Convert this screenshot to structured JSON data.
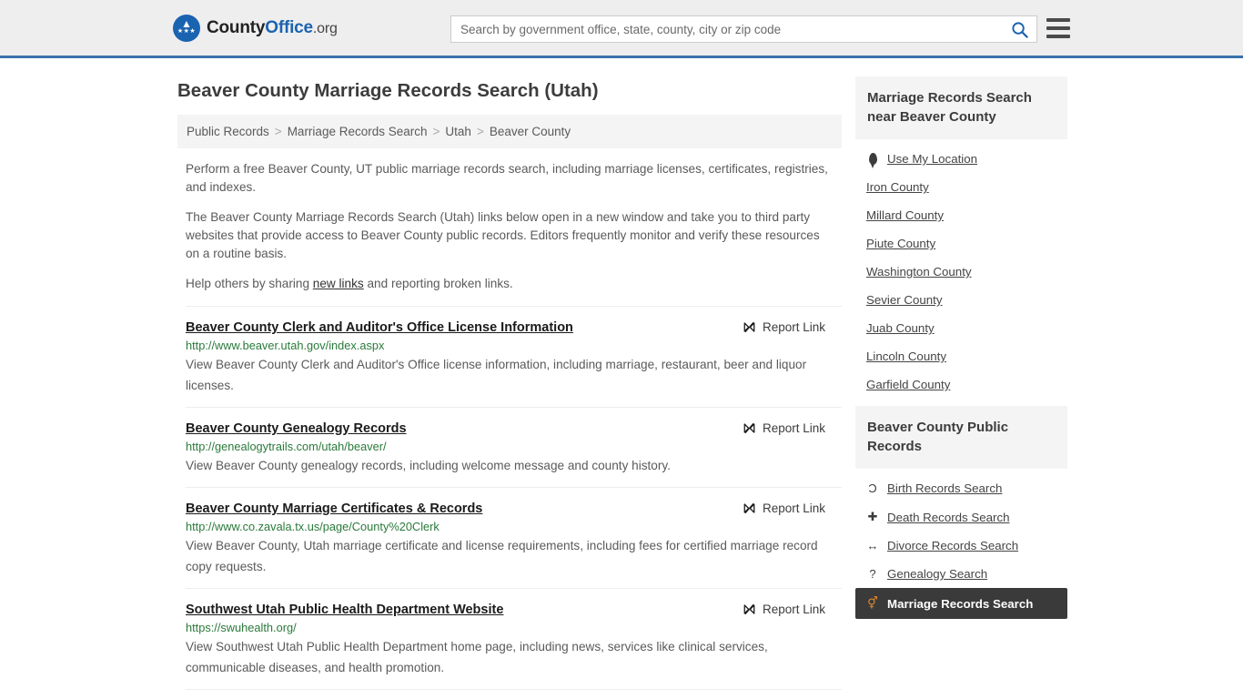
{
  "header": {
    "brand": {
      "part1": "County",
      "part2": "Office",
      "tld": ".org",
      "seal_icon": "eagle-seal-icon"
    },
    "search": {
      "placeholder": "Search by government office, state, county, city or zip code",
      "value": ""
    },
    "search_icon": "search-icon",
    "menu_icon": "hamburger-menu-icon"
  },
  "main": {
    "page_title": "Beaver County Marriage Records Search (Utah)",
    "breadcrumb": [
      "Public Records",
      "Marriage Records Search",
      "Utah",
      "Beaver County"
    ],
    "breadcrumb_separator": ">",
    "intro": {
      "p1": "Perform a free Beaver County, UT public marriage records search, including marriage licenses, certificates, registries, and indexes.",
      "p2": "The Beaver County Marriage Records Search (Utah) links below open in a new window and take you to third party websites that provide access to Beaver County public records. Editors frequently monitor and verify these resources on a routine basis.",
      "p3_before": "Help others by sharing ",
      "p3_link": "new links",
      "p3_after": " and reporting broken links."
    },
    "report_link_label": "Report Link",
    "report_link_icon": "broken-link-icon",
    "results": [
      {
        "title": "Beaver County Clerk and Auditor's Office License Information",
        "url": "http://www.beaver.utah.gov/index.aspx",
        "description": "View Beaver County Clerk and Auditor's Office license information, including marriage, restaurant, beer and liquor licenses."
      },
      {
        "title": "Beaver County Genealogy Records",
        "url": "http://genealogytrails.com/utah/beaver/",
        "description": "View Beaver County genealogy records, including welcome message and county history."
      },
      {
        "title": "Beaver County Marriage Certificates & Records",
        "url": "http://www.co.zavala.tx.us/page/County%20Clerk",
        "description": "View Beaver County, Utah marriage certificate and license requirements, including fees for certified marriage record copy requests."
      },
      {
        "title": "Southwest Utah Public Health Department Website",
        "url": "https://swuhealth.org/",
        "description": "View Southwest Utah Public Health Department home page, including news, services like clinical services, communicable diseases, and health promotion."
      }
    ]
  },
  "sidebar": {
    "nearby": {
      "heading": "Marriage Records Search near Beaver County",
      "items": [
        {
          "label": "Use My Location",
          "icon": "map-pin-icon"
        },
        {
          "label": "Iron County",
          "icon": ""
        },
        {
          "label": "Millard County",
          "icon": ""
        },
        {
          "label": "Piute County",
          "icon": ""
        },
        {
          "label": "Washington County",
          "icon": ""
        },
        {
          "label": "Sevier County",
          "icon": ""
        },
        {
          "label": "Juab County",
          "icon": ""
        },
        {
          "label": "Lincoln County",
          "icon": ""
        },
        {
          "label": "Garfield County",
          "icon": ""
        }
      ]
    },
    "public_records": {
      "heading": "Beaver County Public Records",
      "items": [
        {
          "label": "Birth Records Search",
          "icon": "baby-icon",
          "glyph": "Ɔ",
          "active": false
        },
        {
          "label": "Death Records Search",
          "icon": "cross-icon",
          "glyph": "✚",
          "active": false
        },
        {
          "label": "Divorce Records Search",
          "icon": "double-arrow-icon",
          "glyph": "↔",
          "active": false
        },
        {
          "label": "Genealogy Search",
          "icon": "question-mark-icon",
          "glyph": "?",
          "active": false
        },
        {
          "label": "Marriage Records Search",
          "icon": "venus-mars-icon",
          "glyph": "⚥",
          "active": true
        }
      ]
    }
  },
  "colors": {
    "brand_blue": "#1a63b0",
    "header_bg": "#eeeeee",
    "header_border": "#3a72ab",
    "url_green": "#2a7a3a",
    "panel_head_bg": "#f4f4f4",
    "active_bg": "#3a3a3a",
    "active_icon": "#e08a2e"
  }
}
